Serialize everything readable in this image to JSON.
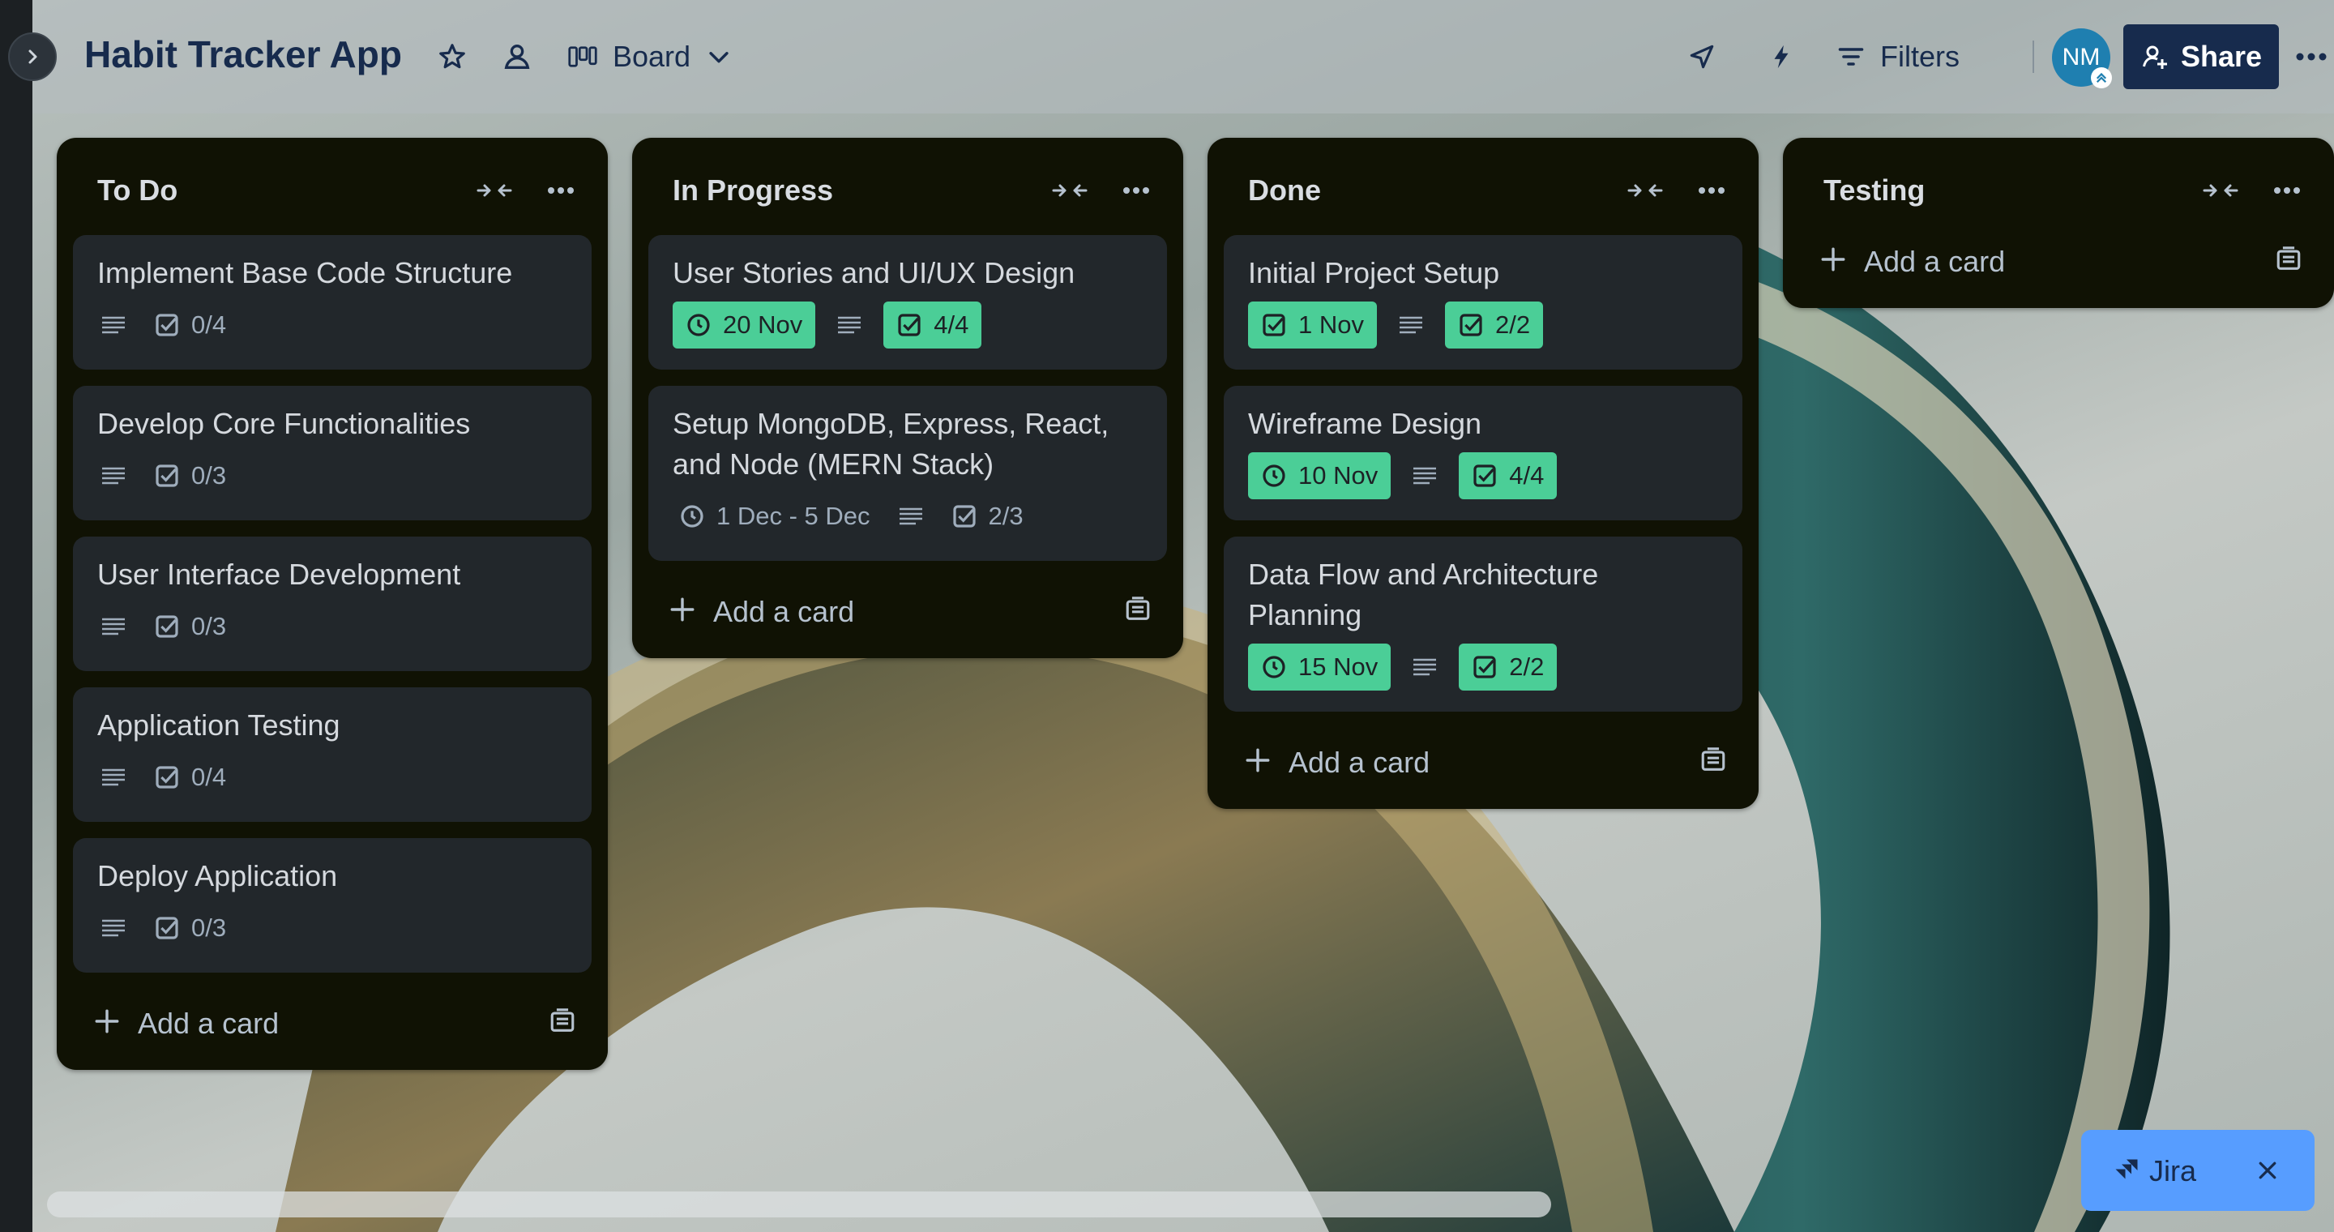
{
  "header": {
    "board_title": "Habit Tracker App",
    "view_label": "Board",
    "filters_label": "Filters",
    "avatar_initials": "NM",
    "share_label": "Share"
  },
  "lists": [
    {
      "title": "To Do",
      "add_card_label": "Add a card",
      "cards": [
        {
          "title": "Implement Base Code Structure",
          "checklist": "0/4"
        },
        {
          "title": "Develop Core Functionalities",
          "checklist": "0/3"
        },
        {
          "title": "User Interface Development",
          "checklist": "0/3"
        },
        {
          "title": "Application Testing",
          "checklist": "0/4"
        },
        {
          "title": "Deploy Application",
          "checklist": "0/3"
        }
      ]
    },
    {
      "title": "In Progress",
      "add_card_label": "Add a card",
      "cards": [
        {
          "title": "User Stories and UI/UX Design",
          "date": "20 Nov",
          "checklist": "4/4"
        },
        {
          "title": "Setup MongoDB, Express, React, and Node (MERN Stack)",
          "date": "1 Dec - 5 Dec",
          "checklist": "2/3"
        }
      ]
    },
    {
      "title": "Done",
      "add_card_label": "Add a card",
      "cards": [
        {
          "title": "Initial Project Setup",
          "date": "1 Nov",
          "checklist": "2/2"
        },
        {
          "title": "Wireframe Design",
          "date": "10 Nov",
          "checklist": "4/4"
        },
        {
          "title": "Data Flow and Architecture Planning",
          "date": "15 Nov",
          "checklist": "2/2"
        }
      ]
    },
    {
      "title": "Testing",
      "add_card_label": "Add a card",
      "cards": []
    }
  ],
  "jira": {
    "label": "Jira"
  },
  "colors": {
    "list_bg": "#101204",
    "card_bg": "#22272b",
    "badge_green": "#4bce97",
    "share_bg": "#172b4d",
    "jira_bg": "#579dff"
  }
}
